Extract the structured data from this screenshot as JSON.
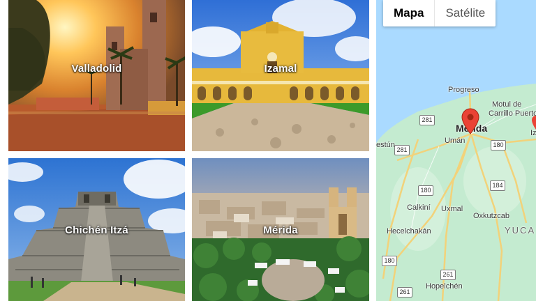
{
  "destinations": [
    {
      "label": "Valladolid"
    },
    {
      "label": "Izamal"
    },
    {
      "label": "Chichén Itzá"
    },
    {
      "label": "Mérida"
    }
  ],
  "map": {
    "type_buttons": {
      "map": "Mapa",
      "satellite": "Satélite"
    },
    "places": {
      "progreso": "Progreso",
      "motul": "Motul de",
      "carrillo": "Carrillo Puerto",
      "merida": "Mérida",
      "uman": "Umán",
      "iz": "Iz",
      "celestun": "estún",
      "calkini": "Calkiní",
      "uxmal": "Uxmal",
      "oxkutzcab": "Oxkutzcab",
      "hecelchakan": "Hecelchakán",
      "hopelchen": "Hopelchén",
      "yucatan": "YUCA"
    },
    "shields": {
      "s281a": "281",
      "s281b": "281",
      "s180a": "180",
      "s180b": "180",
      "s184": "184",
      "s180c": "180",
      "s261a": "261",
      "s261b": "261"
    },
    "colors": {
      "water": "#aadaff",
      "land": "#c4ebd0",
      "road": "#f2d27a",
      "pin": "#ea4335"
    }
  }
}
